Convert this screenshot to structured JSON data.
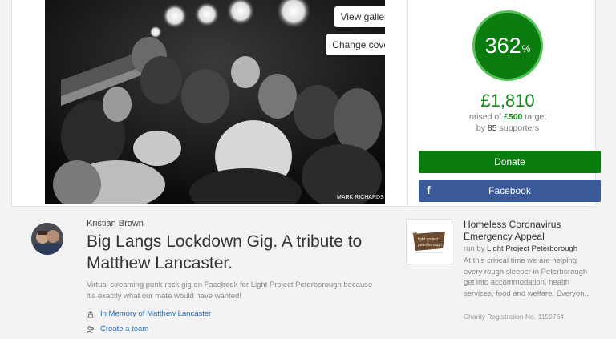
{
  "cover": {
    "view_gallery_label": "View gallery",
    "change_cover_label": "Change cover",
    "watermark": "MARK RICHARDS"
  },
  "stats": {
    "percent": "362",
    "percent_sign": "%",
    "raised": "£1,810",
    "raised_of": "raised of",
    "target_amount": "£500",
    "target_word": "target",
    "by_word": "by",
    "supporters_count": "85",
    "supporters_word": "supporters"
  },
  "actions": {
    "donate_label": "Donate",
    "facebook_label": "Facebook",
    "facebook_icon_glyph": "f"
  },
  "page": {
    "organiser": "Kristian Brown",
    "title": "Big Langs Lockdown Gig. A tribute to Matthew Lancaster.",
    "summary": "Virtual streaming punk-rock gig on Facebook for Light Project Peterborough because it's exactly what our mate would have wanted!",
    "memory_link": "In Memory of Matthew Lancaster",
    "team_link": "Create a team"
  },
  "charity": {
    "name": "Homeless Coronavirus Emergency Appeal",
    "run_by_prefix": "run by",
    "run_by_name": "Light Project Peterborough",
    "description": "At this critical time we are helping every rough sleeper in Peterborough get into accommodation, health services, food and welfare. Everyon...",
    "registration": "Charity Registration No. 1159764",
    "logo_text": "light project peterborough"
  },
  "colors": {
    "primary_green": "#0b7c0f",
    "facebook_blue": "#3b5a9a",
    "link_blue": "#2a6db3"
  }
}
